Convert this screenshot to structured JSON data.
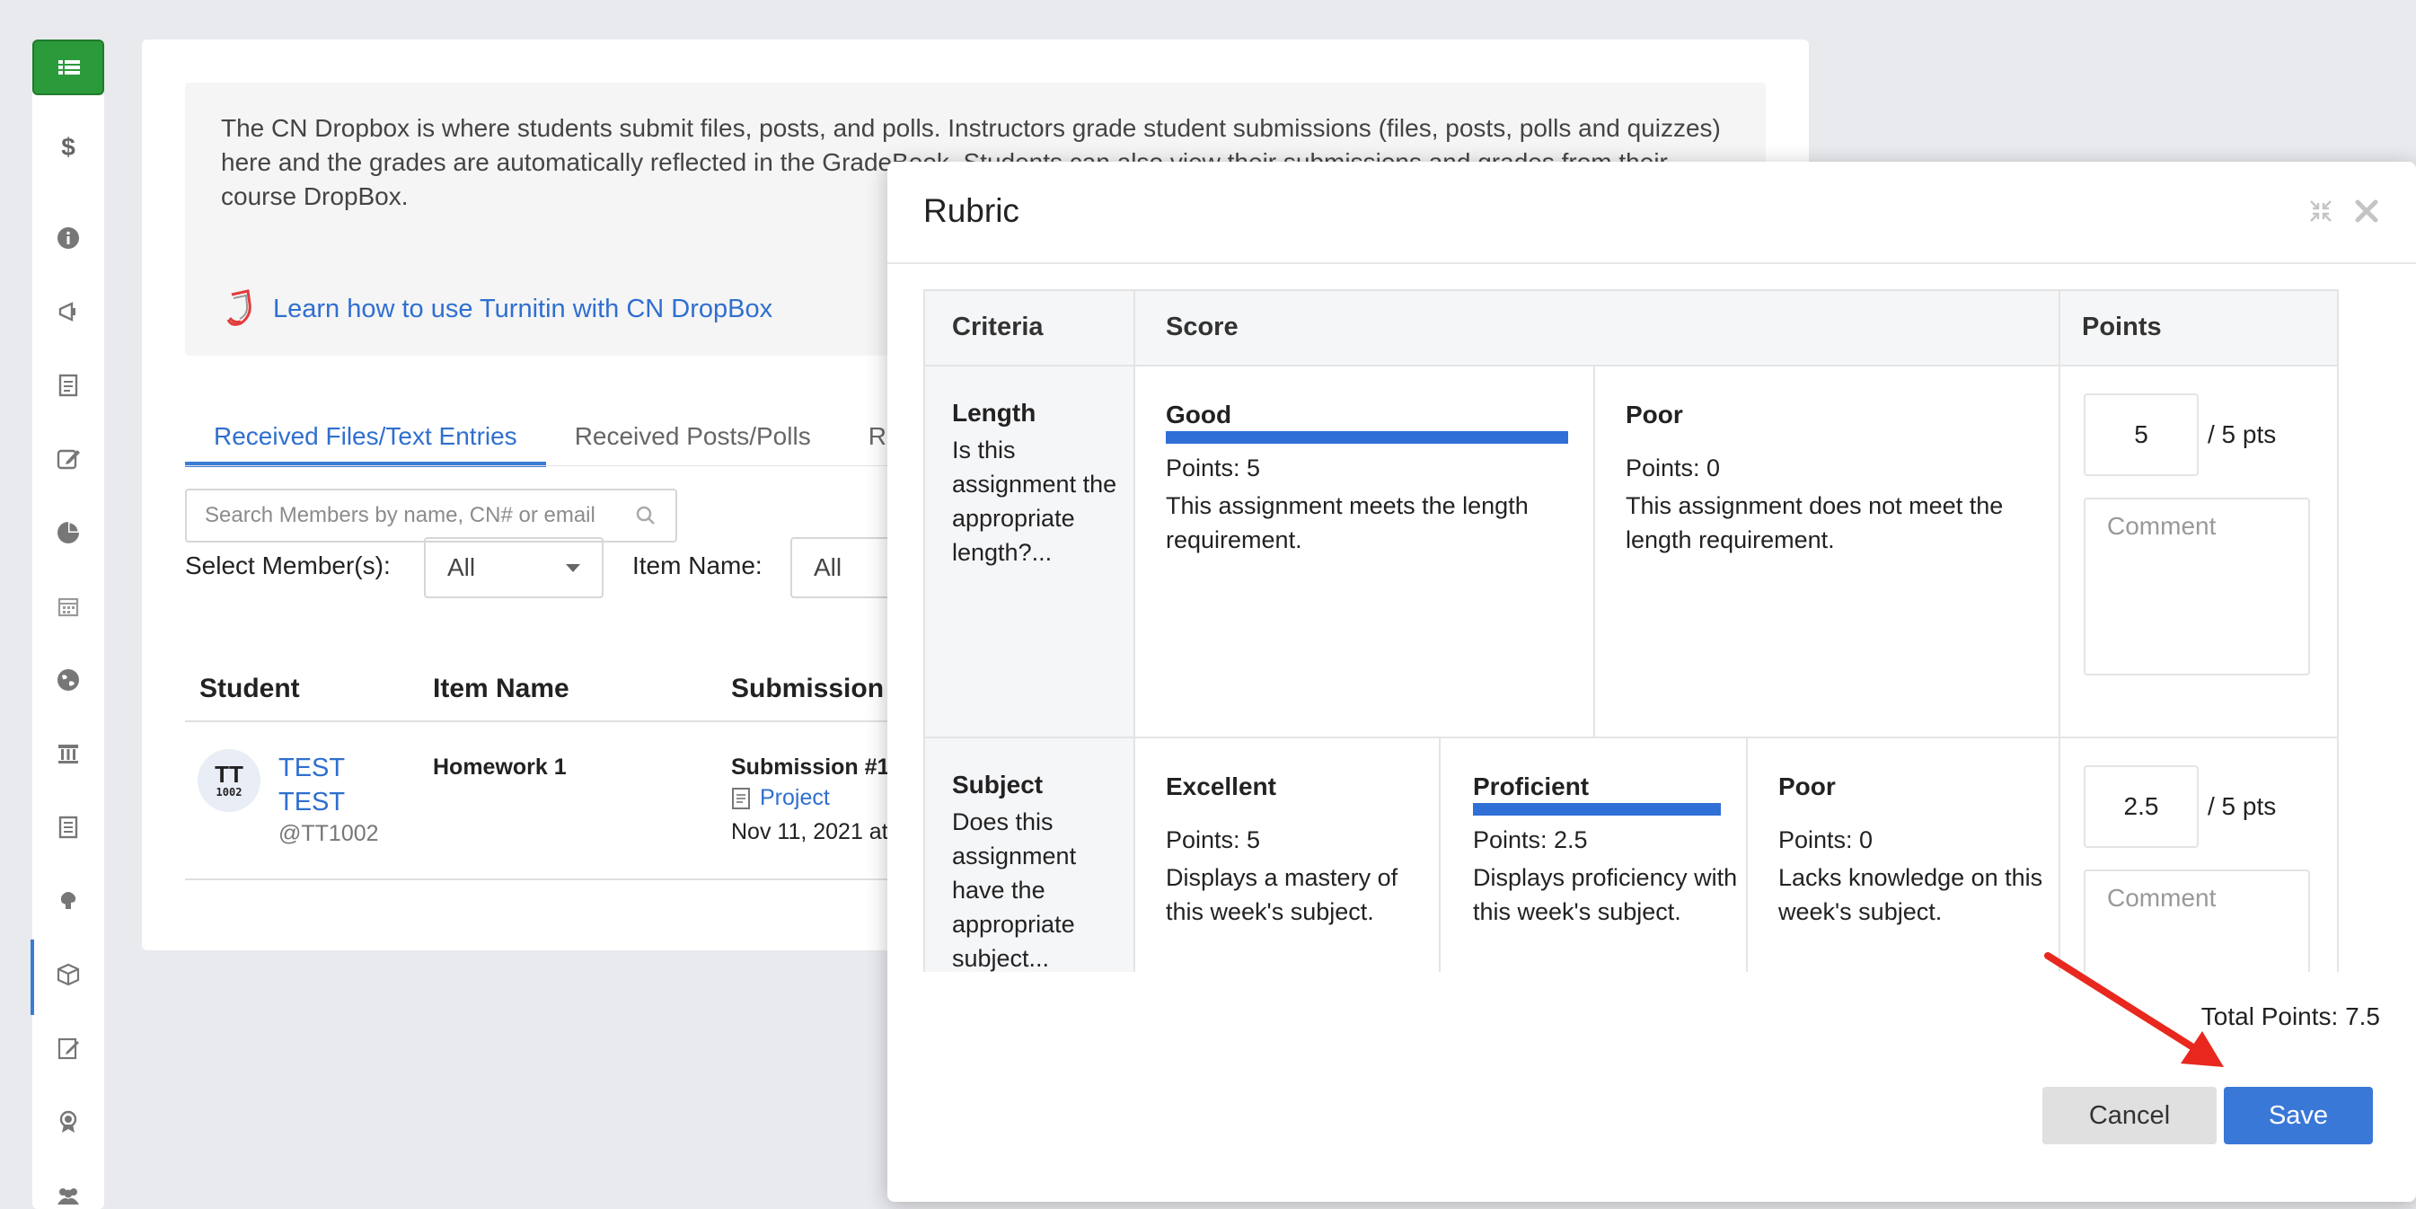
{
  "sidebar": {
    "items": [
      {
        "icon": "list-icon"
      },
      {
        "icon": "dollar-icon"
      },
      {
        "icon": "info-icon"
      },
      {
        "icon": "megaphone-icon"
      },
      {
        "icon": "document-icon"
      },
      {
        "icon": "edit-icon"
      },
      {
        "icon": "pie-chart-icon"
      },
      {
        "icon": "calendar-icon"
      },
      {
        "icon": "globe-icon"
      },
      {
        "icon": "institution-icon"
      },
      {
        "icon": "notes-icon"
      },
      {
        "icon": "brain-icon"
      },
      {
        "icon": "dropbox-icon"
      },
      {
        "icon": "assignment-icon"
      },
      {
        "icon": "award-icon"
      },
      {
        "icon": "users-icon"
      }
    ],
    "active_color": "#2b9a3a"
  },
  "info": {
    "text": "The CN Dropbox is where students submit files, posts, and polls. Instructors grade student submissions (files, posts, polls and quizzes) here and the grades are automatically reflected in the GradeBook. Students can also view their submissions and grades from their course DropBox.",
    "turnitin_link": "Learn how to use Turnitin with CN DropBox"
  },
  "tabs": [
    {
      "label": "Received Files/Text Entries",
      "active": true
    },
    {
      "label": "Received Posts/Polls",
      "active": false
    },
    {
      "label": "Re",
      "active": false
    }
  ],
  "search": {
    "placeholder": "Search Members by name, CN# or email"
  },
  "filters": {
    "member_label": "Select Member(s):",
    "member_value": "All",
    "item_label": "Item Name:",
    "item_value": "All"
  },
  "table": {
    "headers": {
      "student": "Student",
      "item_name": "Item Name",
      "submission": "Submission"
    },
    "rows": [
      {
        "avatar_initials": "TT",
        "avatar_id": "1002",
        "first_name": "TEST",
        "last_name": "TEST",
        "handle": "@TT1002",
        "item_name": "Homework 1",
        "submission": "Submission #1",
        "file_label": "Project",
        "date": "Nov 11, 2021 at"
      }
    ]
  },
  "modal": {
    "title": "Rubric",
    "headers": {
      "criteria": "Criteria",
      "score": "Score",
      "points": "Points"
    },
    "criteria": [
      {
        "title": "Length",
        "description": "Is this assignment the appropriate length?...",
        "levels": [
          {
            "title": "Good",
            "points": "Points: 5",
            "description": "This assignment meets the length requirement.",
            "selected": true
          },
          {
            "title": "Poor",
            "points": "Points: 0",
            "description": "This assignment does not meet the length requirement.",
            "selected": false
          }
        ],
        "score": "5",
        "max": "/ 5 pts",
        "comment_placeholder": "Comment"
      },
      {
        "title": "Subject",
        "description": "Does this assignment have the appropriate subject...",
        "levels": [
          {
            "title": "Excellent",
            "points": "Points: 5",
            "description": "Displays a mastery of this week's subject.",
            "selected": false
          },
          {
            "title": "Proficient",
            "points": "Points: 2.5",
            "description": "Displays proficiency with this week's subject.",
            "selected": true
          },
          {
            "title": "Poor",
            "points": "Points: 0",
            "description": "Lacks knowledge on this week's subject.",
            "selected": false
          }
        ],
        "score": "2.5",
        "max": "/ 5 pts",
        "comment_placeholder": "Comment"
      }
    ],
    "total": "Total Points: 7.5",
    "cancel_label": "Cancel",
    "save_label": "Save",
    "accent": "#3a78d8"
  },
  "annotation": {
    "arrow_color": "#e8281e"
  }
}
